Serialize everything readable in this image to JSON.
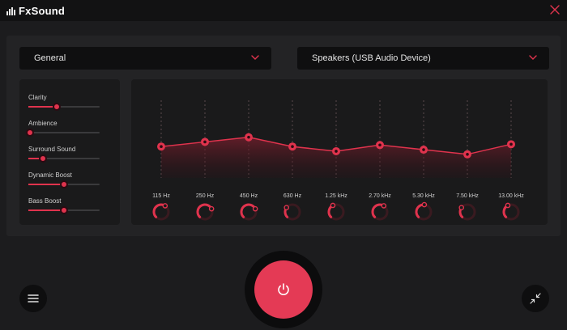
{
  "app": {
    "title": "FxSound",
    "close_icon": "close-icon",
    "accent_color": "#e0334d"
  },
  "preset_dropdown": {
    "selected": "General"
  },
  "output_dropdown": {
    "selected": "Speakers (USB Audio Device)"
  },
  "effects": [
    {
      "label": "Clarity",
      "value": 0.4
    },
    {
      "label": "Ambience",
      "value": 0.02
    },
    {
      "label": "Surround Sound",
      "value": 0.2
    },
    {
      "label": "Dynamic Boost",
      "value": 0.5
    },
    {
      "label": "Bass Boost",
      "value": 0.5
    }
  ],
  "equalizer": {
    "bands": [
      {
        "label": "115 Hz",
        "level": 0.3,
        "knob": 0.62
      },
      {
        "label": "250 Hz",
        "level": 0.36,
        "knob": 0.74
      },
      {
        "label": "450 Hz",
        "level": 0.42,
        "knob": 0.74
      },
      {
        "label": "630 Hz",
        "level": 0.3,
        "knob": 0.3
      },
      {
        "label": "1.25 kHz",
        "level": 0.24,
        "knob": 0.4
      },
      {
        "label": "2.70 kHz",
        "level": 0.32,
        "knob": 0.62
      },
      {
        "label": "5.30 kHz",
        "level": 0.26,
        "knob": 0.52
      },
      {
        "label": "7.50 kHz",
        "level": 0.2,
        "knob": 0.3
      },
      {
        "label": "13.00 kHz",
        "level": 0.33,
        "knob": 0.4
      }
    ]
  },
  "controls": {
    "menu_icon": "hamburger-menu-icon",
    "power_icon": "power-icon",
    "minimize_icon": "collapse-arrows-icon"
  }
}
